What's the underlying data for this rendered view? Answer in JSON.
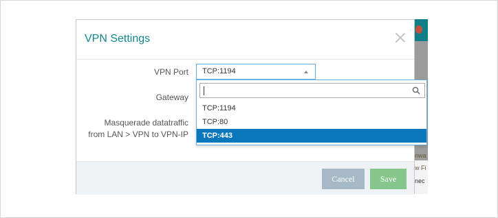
{
  "modal": {
    "title": "VPN Settings",
    "fields": {
      "vpn_port_label": "VPN Port",
      "gateway_label": "Gateway",
      "masquerade_label_line1": "Masquerade datatraffic",
      "masquerade_label_line2": "from LAN > VPN to VPN-IP"
    },
    "vpn_port_value": "TCP:1194",
    "buttons": {
      "cancel": "Cancel",
      "save": "Save"
    }
  },
  "dropdown": {
    "search_value": "",
    "options": [
      "TCP:1194",
      "TCP:80",
      "TCP:443"
    ],
    "highlighted": "TCP:443"
  },
  "background_fragments": [
    "nwa",
    "w Fi",
    "nec"
  ],
  "colors": {
    "title": "#138489",
    "highlight": "#0b78bd",
    "cancel_button": "#a5bac6",
    "save_button": "#86c68d",
    "footer": "#eef2f5"
  },
  "icons": {
    "close": "close-icon",
    "search": "search-icon",
    "caret": "caret-up-icon"
  }
}
